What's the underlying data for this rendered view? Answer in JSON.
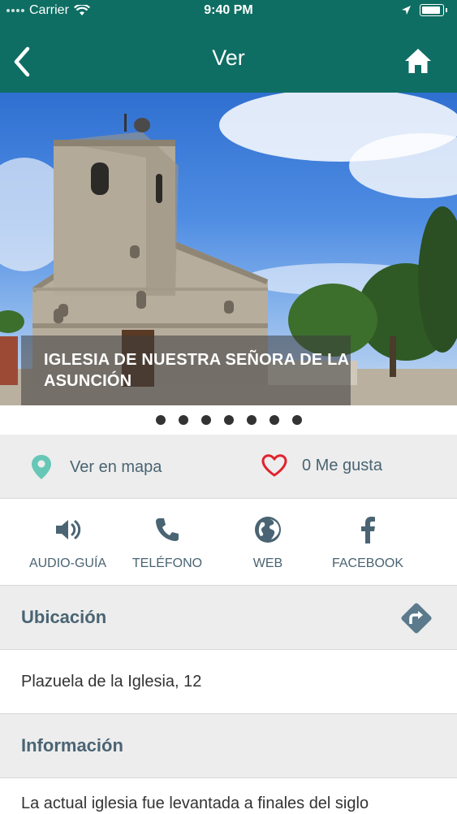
{
  "status_bar": {
    "carrier": "Carrier",
    "time": "9:40 PM"
  },
  "nav": {
    "title": "Ver",
    "back_icon": "chevron-left-icon",
    "home_icon": "home-icon"
  },
  "hero": {
    "caption": "IGLESIA DE NUESTRA SEÑORA DE LA ASUNCIÓN",
    "page_count": 7
  },
  "actions": {
    "map_label": "Ver en mapa",
    "like_label": "0 Me gusta"
  },
  "contact": {
    "audio_label": "AUDIO-GUÍA",
    "phone_label": "TELÉFONO",
    "web_label": "WEB",
    "facebook_label": "FACEBOOK"
  },
  "location": {
    "title": "Ubicación",
    "address": "Plazuela de la Iglesia, 12"
  },
  "information": {
    "title": "Información",
    "text": "La actual iglesia fue levantada a finales del siglo"
  },
  "colors": {
    "header": "#0e6e63",
    "text_muted": "#4a6473",
    "pin": "#67c7b6",
    "heart": "#e0232f",
    "directions": "#5b7b8c"
  }
}
